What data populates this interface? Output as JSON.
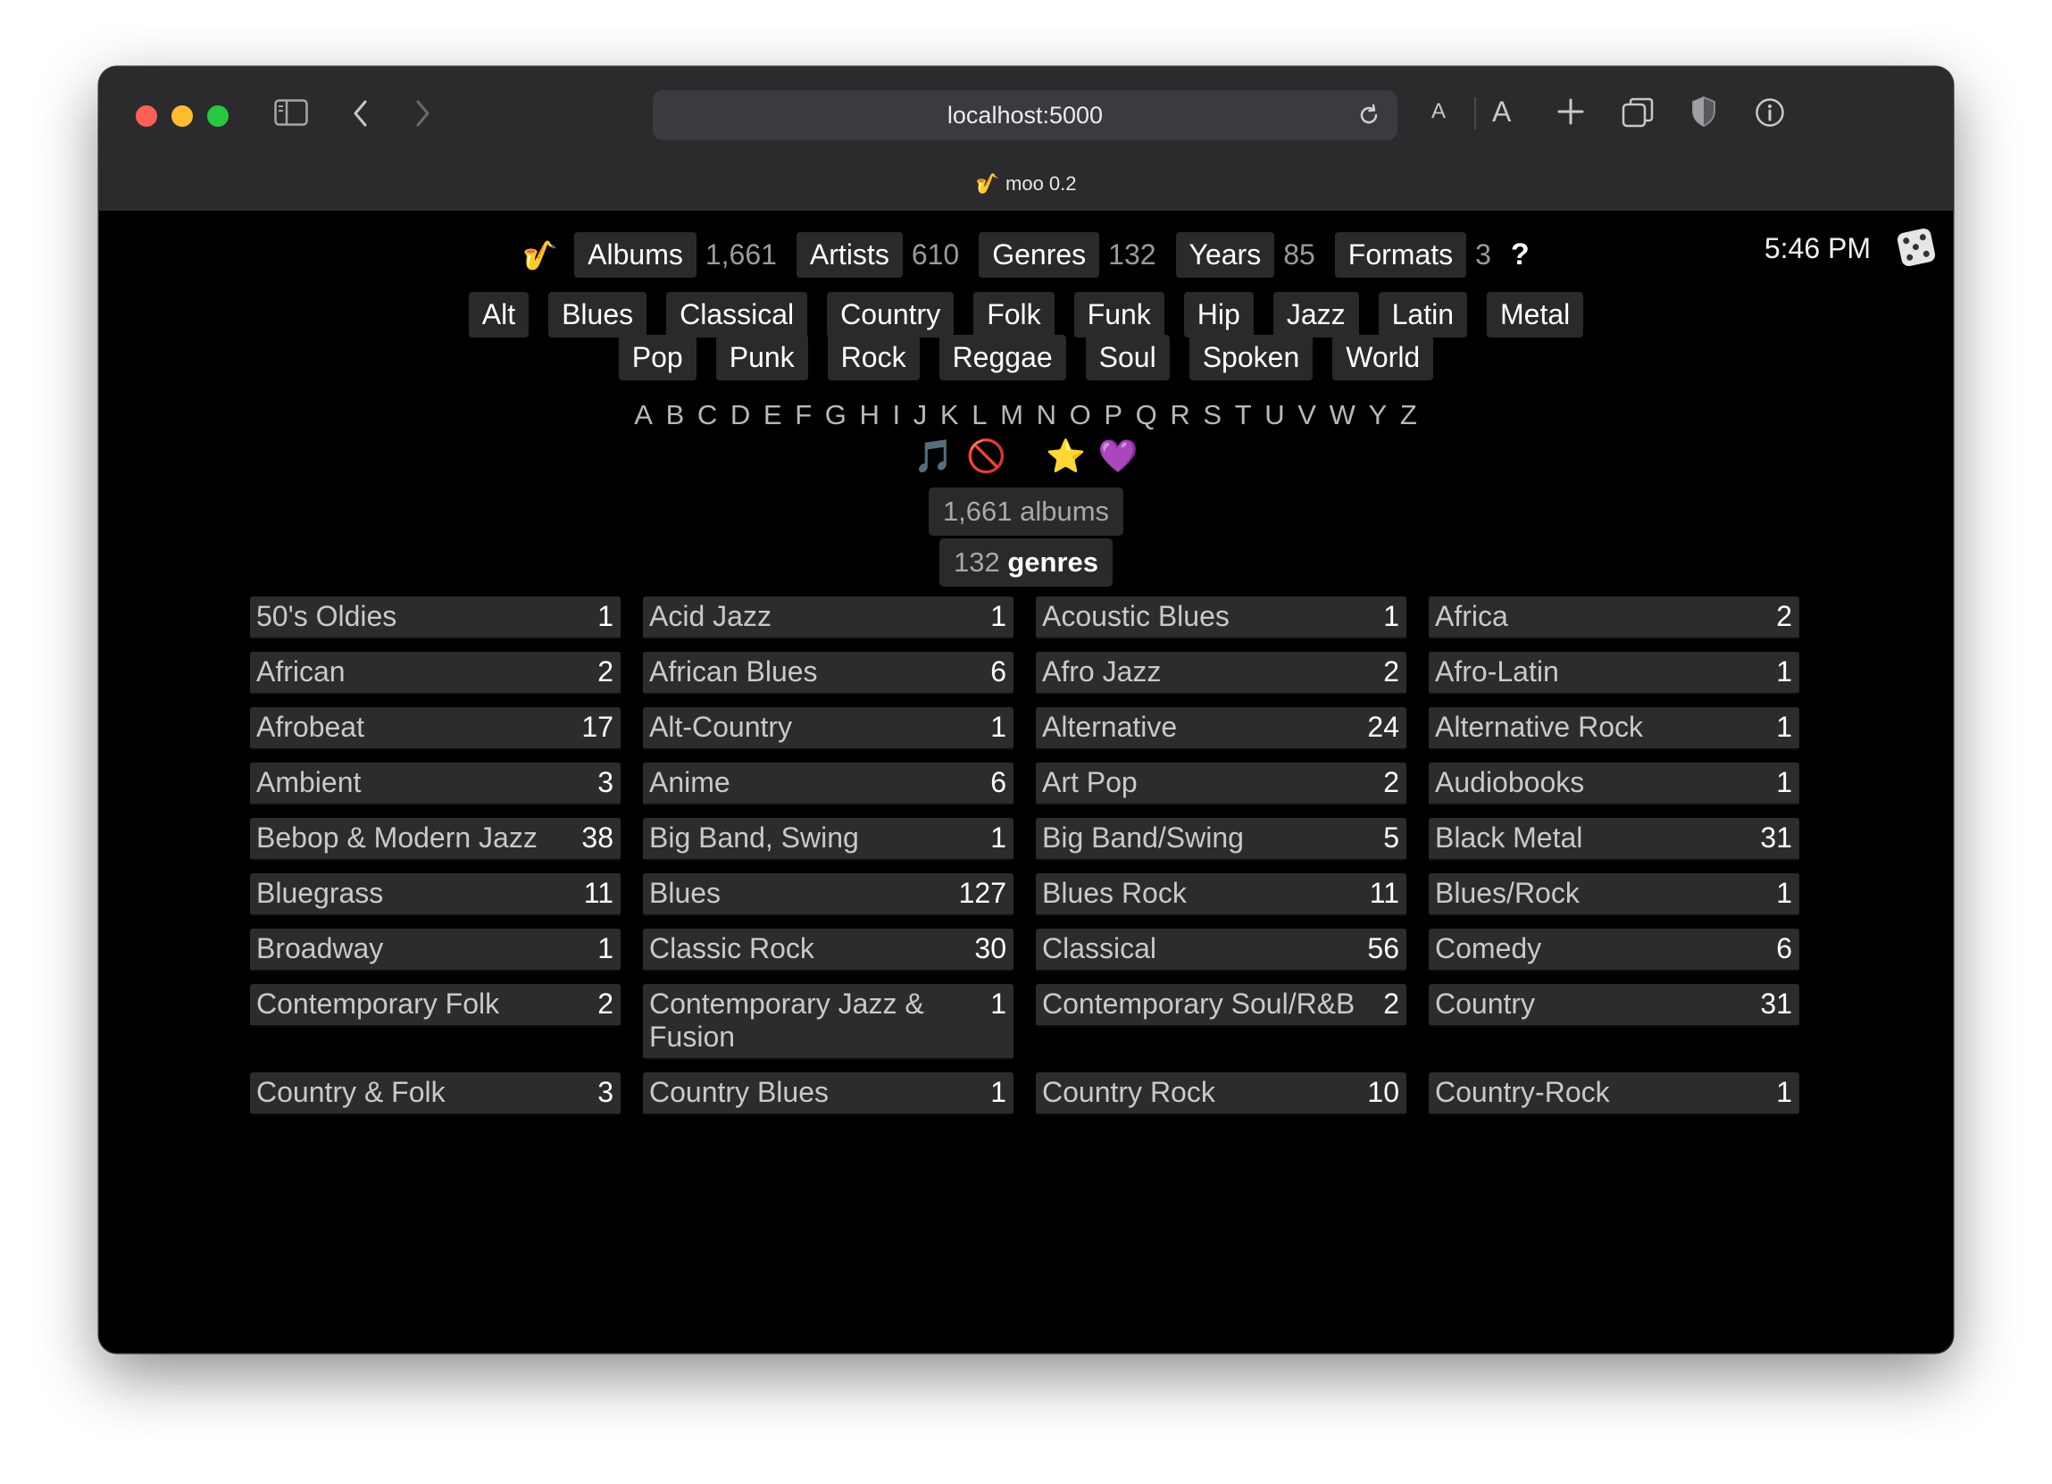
{
  "browser": {
    "url": "localhost:5000",
    "tab_title": "🎷 moo 0.2"
  },
  "header": {
    "logo": "🎷",
    "stats": [
      {
        "label": "Albums",
        "count": "1,661"
      },
      {
        "label": "Artists",
        "count": "610"
      },
      {
        "label": "Genres",
        "count": "132"
      },
      {
        "label": "Years",
        "count": "85"
      },
      {
        "label": "Formats",
        "count": "3"
      }
    ],
    "help": "?",
    "time": "5:46 PM"
  },
  "genre_chips_row1": [
    "Alt",
    "Blues",
    "Classical",
    "Country",
    "Folk",
    "Funk",
    "Hip",
    "Jazz",
    "Latin",
    "Metal"
  ],
  "genre_chips_row2": [
    "Pop",
    "Punk",
    "Rock",
    "Reggae",
    "Soul",
    "Spoken",
    "World"
  ],
  "alphabet": [
    "A",
    "B",
    "C",
    "D",
    "E",
    "F",
    "G",
    "H",
    "I",
    "J",
    "K",
    "L",
    "M",
    "N",
    "O",
    "P",
    "Q",
    "R",
    "S",
    "T",
    "U",
    "V",
    "W",
    "Y",
    "Z"
  ],
  "filters": {
    "music": "🎵",
    "none": "🚫",
    "star": "⭐",
    "heart": "💜"
  },
  "summary": {
    "albums": "1,661 albums",
    "genres_count": "132",
    "genres_word": "genres"
  },
  "genres": [
    [
      {
        "name": "50's Oldies",
        "count": "1"
      },
      {
        "name": "Acid Jazz",
        "count": "1"
      },
      {
        "name": "Acoustic Blues",
        "count": "1"
      },
      {
        "name": "Africa",
        "count": "2"
      }
    ],
    [
      {
        "name": "African",
        "count": "2"
      },
      {
        "name": "African Blues",
        "count": "6"
      },
      {
        "name": "Afro Jazz",
        "count": "2"
      },
      {
        "name": "Afro-Latin",
        "count": "1"
      }
    ],
    [
      {
        "name": "Afrobeat",
        "count": "17"
      },
      {
        "name": "Alt-Country",
        "count": "1"
      },
      {
        "name": "Alternative",
        "count": "24"
      },
      {
        "name": "Alternative Rock",
        "count": "1"
      }
    ],
    [
      {
        "name": "Ambient",
        "count": "3"
      },
      {
        "name": "Anime",
        "count": "6"
      },
      {
        "name": "Art Pop",
        "count": "2"
      },
      {
        "name": "Audiobooks",
        "count": "1"
      }
    ],
    [
      {
        "name": "Bebop & Modern Jazz",
        "count": "38"
      },
      {
        "name": "Big Band, Swing",
        "count": "1"
      },
      {
        "name": "Big Band/Swing",
        "count": "5"
      },
      {
        "name": "Black Metal",
        "count": "31"
      }
    ],
    [
      {
        "name": "Bluegrass",
        "count": "11"
      },
      {
        "name": "Blues",
        "count": "127"
      },
      {
        "name": "Blues Rock",
        "count": "11"
      },
      {
        "name": "Blues/Rock",
        "count": "1"
      }
    ],
    [
      {
        "name": "Broadway",
        "count": "1"
      },
      {
        "name": "Classic Rock",
        "count": "30"
      },
      {
        "name": "Classical",
        "count": "56"
      },
      {
        "name": "Comedy",
        "count": "6"
      }
    ],
    [
      {
        "name": "Contemporary Folk",
        "count": "2"
      },
      {
        "name": "Contemporary Jazz & Fusion",
        "count": "1"
      },
      {
        "name": "Contemporary Soul/R&B",
        "count": "2"
      },
      {
        "name": "Country",
        "count": "31"
      }
    ],
    [
      {
        "name": "Country & Folk",
        "count": "3"
      },
      {
        "name": "Country Blues",
        "count": "1"
      },
      {
        "name": "Country Rock",
        "count": "10"
      },
      {
        "name": "Country-Rock",
        "count": "1"
      }
    ]
  ]
}
